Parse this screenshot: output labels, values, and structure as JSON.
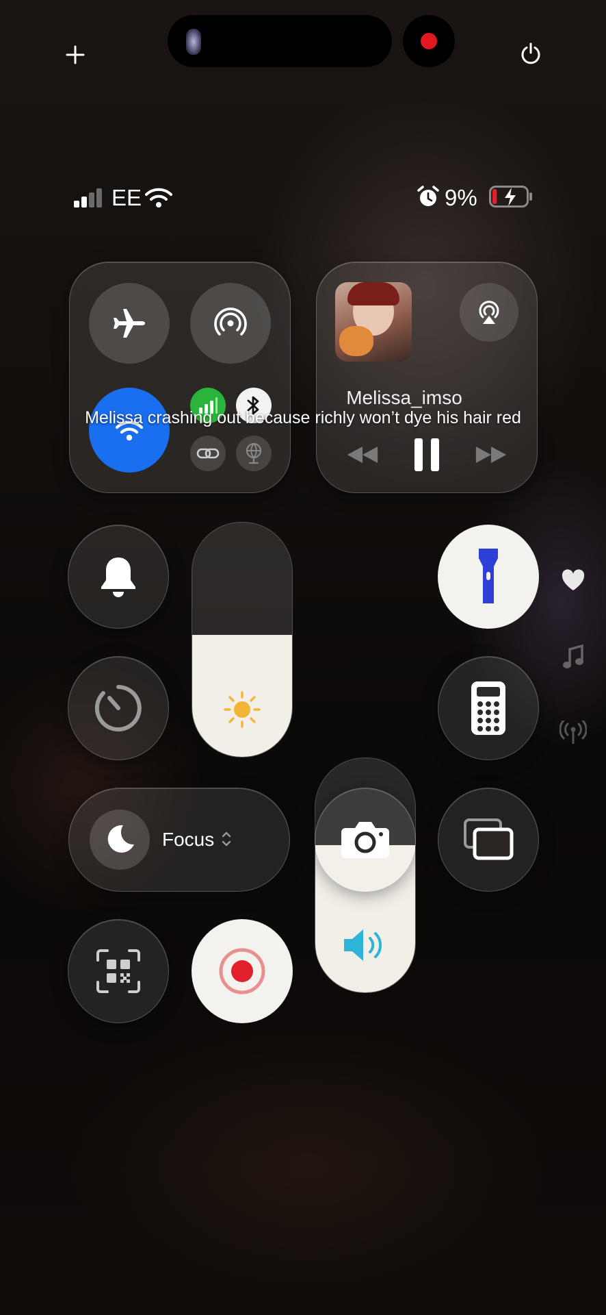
{
  "top_bar": {
    "add_icon": "plus-icon",
    "power_icon": "power-icon",
    "recording_color": "#e0181f"
  },
  "status_bar": {
    "carrier": "EE",
    "battery_percent": "9%",
    "battery_level": 0.09,
    "icons": [
      "signal-icon",
      "wifi-icon",
      "alarm-icon",
      "battery-icon"
    ]
  },
  "connectivity": {
    "airplane_icon": "airplane-icon",
    "hotspot_icon": "airdrop-icon",
    "wifi_icon": "wifi-icon",
    "cellular_icon": "cellular-icon",
    "bluetooth_icon": "bluetooth-icon",
    "link_icon": "link-icon",
    "vpn_icon": "globe-icon",
    "wifi_color": "#1a6ef0",
    "cellular_color": "#2bb43c"
  },
  "now_playing": {
    "title": "Melissa_imso",
    "airplay_icon": "airplay-icon"
  },
  "caption": {
    "text": "Melissa crashing out because richly won’t dye his hair red"
  },
  "controls": {
    "brightness_level": 0.52,
    "volume_level": 0.63,
    "focus_label": "Focus",
    "accent_flashlight": "#2d3fd6",
    "accent_sun": "#f2b634",
    "accent_volume": "#2db4d8",
    "record_color": "#e0202a"
  },
  "side_rail": {
    "icons": [
      "heart-icon",
      "music-note-icon",
      "antenna-icon"
    ]
  }
}
